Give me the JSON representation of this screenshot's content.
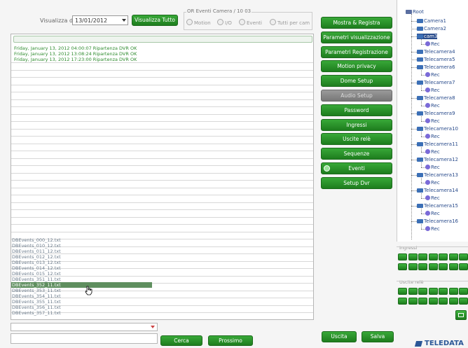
{
  "toolbar": {
    "date_label": "Visualizza dal:",
    "date_value": "13/01/2012",
    "show_all": "Visualizza Tutto",
    "filter_legend": "OR Eventi Camera / 10 03",
    "filters": [
      "Motion",
      "I/O",
      "Eventi",
      "Tutti per cam"
    ]
  },
  "log": {
    "entries": [
      "Friday, January 13, 2012 04:00:07 Ripartenza DVR OK",
      "Friday, January 13, 2012 13:08:24 Ripartenza DVR OK",
      "Friday, January 13, 2012 17:23:00 Ripartenza DVR OK"
    ],
    "files": [
      "DBEvents_000_12.txt",
      "DBEvents_010_12.txt",
      "DBEvents_011_12.txt",
      "DBEvents_012_12.txt",
      "DBEvents_013_12.txt",
      "DBEvents_014_12.txt",
      "DBEvents_015_12.txt",
      "DBEvents_351_11.txt",
      "DBEvents_352_11.txt",
      "DBEvents_353_11.txt",
      "DBEvents_354_11.txt",
      "DBEvents_355_11.txt",
      "DBEvents_356_11.txt",
      "DBEvents_357_11.txt"
    ],
    "selected_file_index": 8
  },
  "bottom": {
    "search_label": "Cerca",
    "next_label": "Prossimo",
    "exit_label": "Uscita",
    "save_label": "Salva"
  },
  "menu": [
    "Mostra & Registra",
    "Parametri visualizzazione",
    "Parametri Registrazione",
    "Motion privacy",
    "Dome Setup",
    "Audio Setup",
    "Password",
    "Ingressi",
    "Uscite relè",
    "Sequenze",
    "Eventi",
    "Setup Dvr"
  ],
  "tree": {
    "root": "Root",
    "nodes": [
      {
        "label": "Camera1",
        "rec": false
      },
      {
        "label": "Camera2",
        "rec": false
      },
      {
        "label": "cam3",
        "rec": true,
        "selected": true
      },
      {
        "label": "Telecamera4",
        "rec": false
      },
      {
        "label": "Telecamera5",
        "rec": false
      },
      {
        "label": "Telecamera6",
        "rec": true
      },
      {
        "label": "Telecamera7",
        "rec": true
      },
      {
        "label": "Telecamera8",
        "rec": true
      },
      {
        "label": "Telecamera9",
        "rec": true
      },
      {
        "label": "Telecamera10",
        "rec": true
      },
      {
        "label": "Telecamera11",
        "rec": true
      },
      {
        "label": "Telecamera12",
        "rec": true
      },
      {
        "label": "Telecamera13",
        "rec": true
      },
      {
        "label": "Telecamera14",
        "rec": true
      },
      {
        "label": "Telecamera15",
        "rec": true
      },
      {
        "label": "Telecamera16",
        "rec": true
      }
    ],
    "rec_label": "Rec"
  },
  "io": {
    "inputs_title": "Ingressi",
    "outputs_title": "Uscite relè"
  },
  "brand": "TELEDATA",
  "colors": {
    "accent": "#1e7d1e",
    "log_text": "#2e8b2e",
    "selection": "#5f8f5f"
  }
}
